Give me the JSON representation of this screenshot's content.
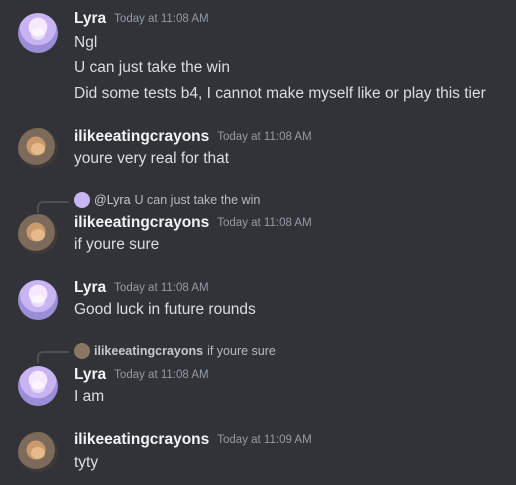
{
  "messages": [
    {
      "author": "Lyra",
      "time": "Today at 11:08 AM",
      "lines": [
        "Ngl",
        "U can just take the win",
        "Did some tests b4, I cannot make myself like or play this tier"
      ]
    },
    {
      "author": "ilikeeatingcrayons",
      "time": "Today at 11:08 AM",
      "lines": [
        "youre very real for that"
      ]
    },
    {
      "author": "ilikeeatingcrayons",
      "time": "Today at 11:08 AM",
      "lines": [
        "if youre sure"
      ],
      "reply": {
        "author": "@Lyra",
        "text": "U can just take the win"
      }
    },
    {
      "author": "Lyra",
      "time": "Today at 11:08 AM",
      "lines": [
        "Good luck in future rounds"
      ]
    },
    {
      "author": "Lyra",
      "time": "Today at 11:08 AM",
      "lines": [
        "I am"
      ],
      "reply": {
        "author": "ilikeeatingcrayons",
        "text": "if youre sure"
      }
    },
    {
      "author": "ilikeeatingcrayons",
      "time": "Today at 11:09 AM",
      "lines": [
        "tyty"
      ]
    }
  ],
  "avatars": {
    "Lyra": "lyra-avatar",
    "ilikeeatingcrayons": "cat-avatar"
  },
  "colors": {
    "background": "#313338",
    "username": "#f2f3f5",
    "timestamp": "#949ba4",
    "text": "#dbdee1"
  }
}
